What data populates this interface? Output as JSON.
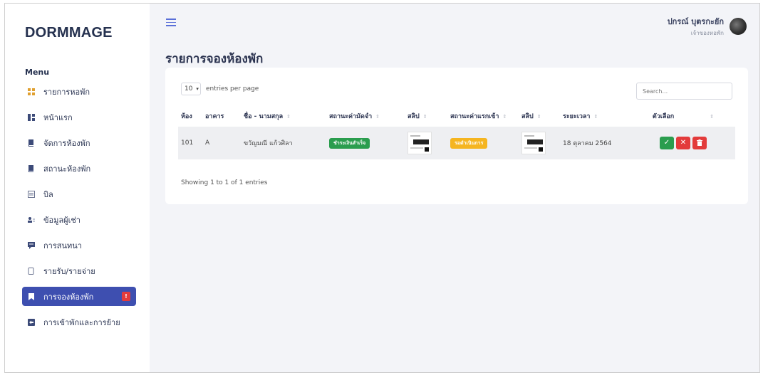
{
  "sidebar": {
    "brand": "DORMMAGE",
    "menu_title": "Menu",
    "items": [
      {
        "label": "รายการหอพัก",
        "icon": "grid-icon",
        "active": false
      },
      {
        "label": "หน้าแรก",
        "icon": "dashboard-icon",
        "active": false
      },
      {
        "label": "จัดการห้องพัก",
        "icon": "book-icon",
        "active": false
      },
      {
        "label": "สถานะห้องพัก",
        "icon": "book-icon",
        "active": false
      },
      {
        "label": "บิล",
        "icon": "receipt-icon",
        "active": false
      },
      {
        "label": "ข้อมูลผู้เช่า",
        "icon": "users-icon",
        "active": false
      },
      {
        "label": "การสนทนา",
        "icon": "chat-icon",
        "active": false
      },
      {
        "label": "รายรับ/รายจ่าย",
        "icon": "wallet-icon",
        "active": false
      },
      {
        "label": "การจองห้องพัก",
        "icon": "bookmark-icon",
        "active": true,
        "badge": "!"
      },
      {
        "label": "การเข้าพักและการย้าย",
        "icon": "exit-icon",
        "active": false
      }
    ]
  },
  "header": {
    "user_name": "ปกรณ์ บุตรกะยัก",
    "user_role": "เจ้าของหอพัก"
  },
  "page": {
    "title": "รายการจองห้องพัก"
  },
  "table_controls": {
    "page_length": "10",
    "entries_label": "entries per page",
    "search_placeholder": "Search..."
  },
  "table": {
    "headers": [
      "ห้อง",
      "อาคาร",
      "ชื่อ - นามสกุล",
      "สถานะค่ามัดจำ",
      "สลิป",
      "สถานะค่าแรกเข้า",
      "สลิป",
      "ระยะเวลา",
      "ตัวเลือก"
    ],
    "rows": [
      {
        "room": "101",
        "building": "A",
        "name": "ขวัญมณี แก้วศิลา",
        "deposit_status": "ชำระเงินสำเร็จ",
        "entry_status": "รอดำเนินการ",
        "duration": "18 ตุลาคม 2564"
      }
    ],
    "info": "Showing 1 to 1 of 1 entries"
  },
  "colors": {
    "sidebar_active": "#3e4fb0",
    "success": "#2a9d4e",
    "danger": "#e33b3b",
    "warning": "#f5b520",
    "background": "#f3f4f8"
  }
}
